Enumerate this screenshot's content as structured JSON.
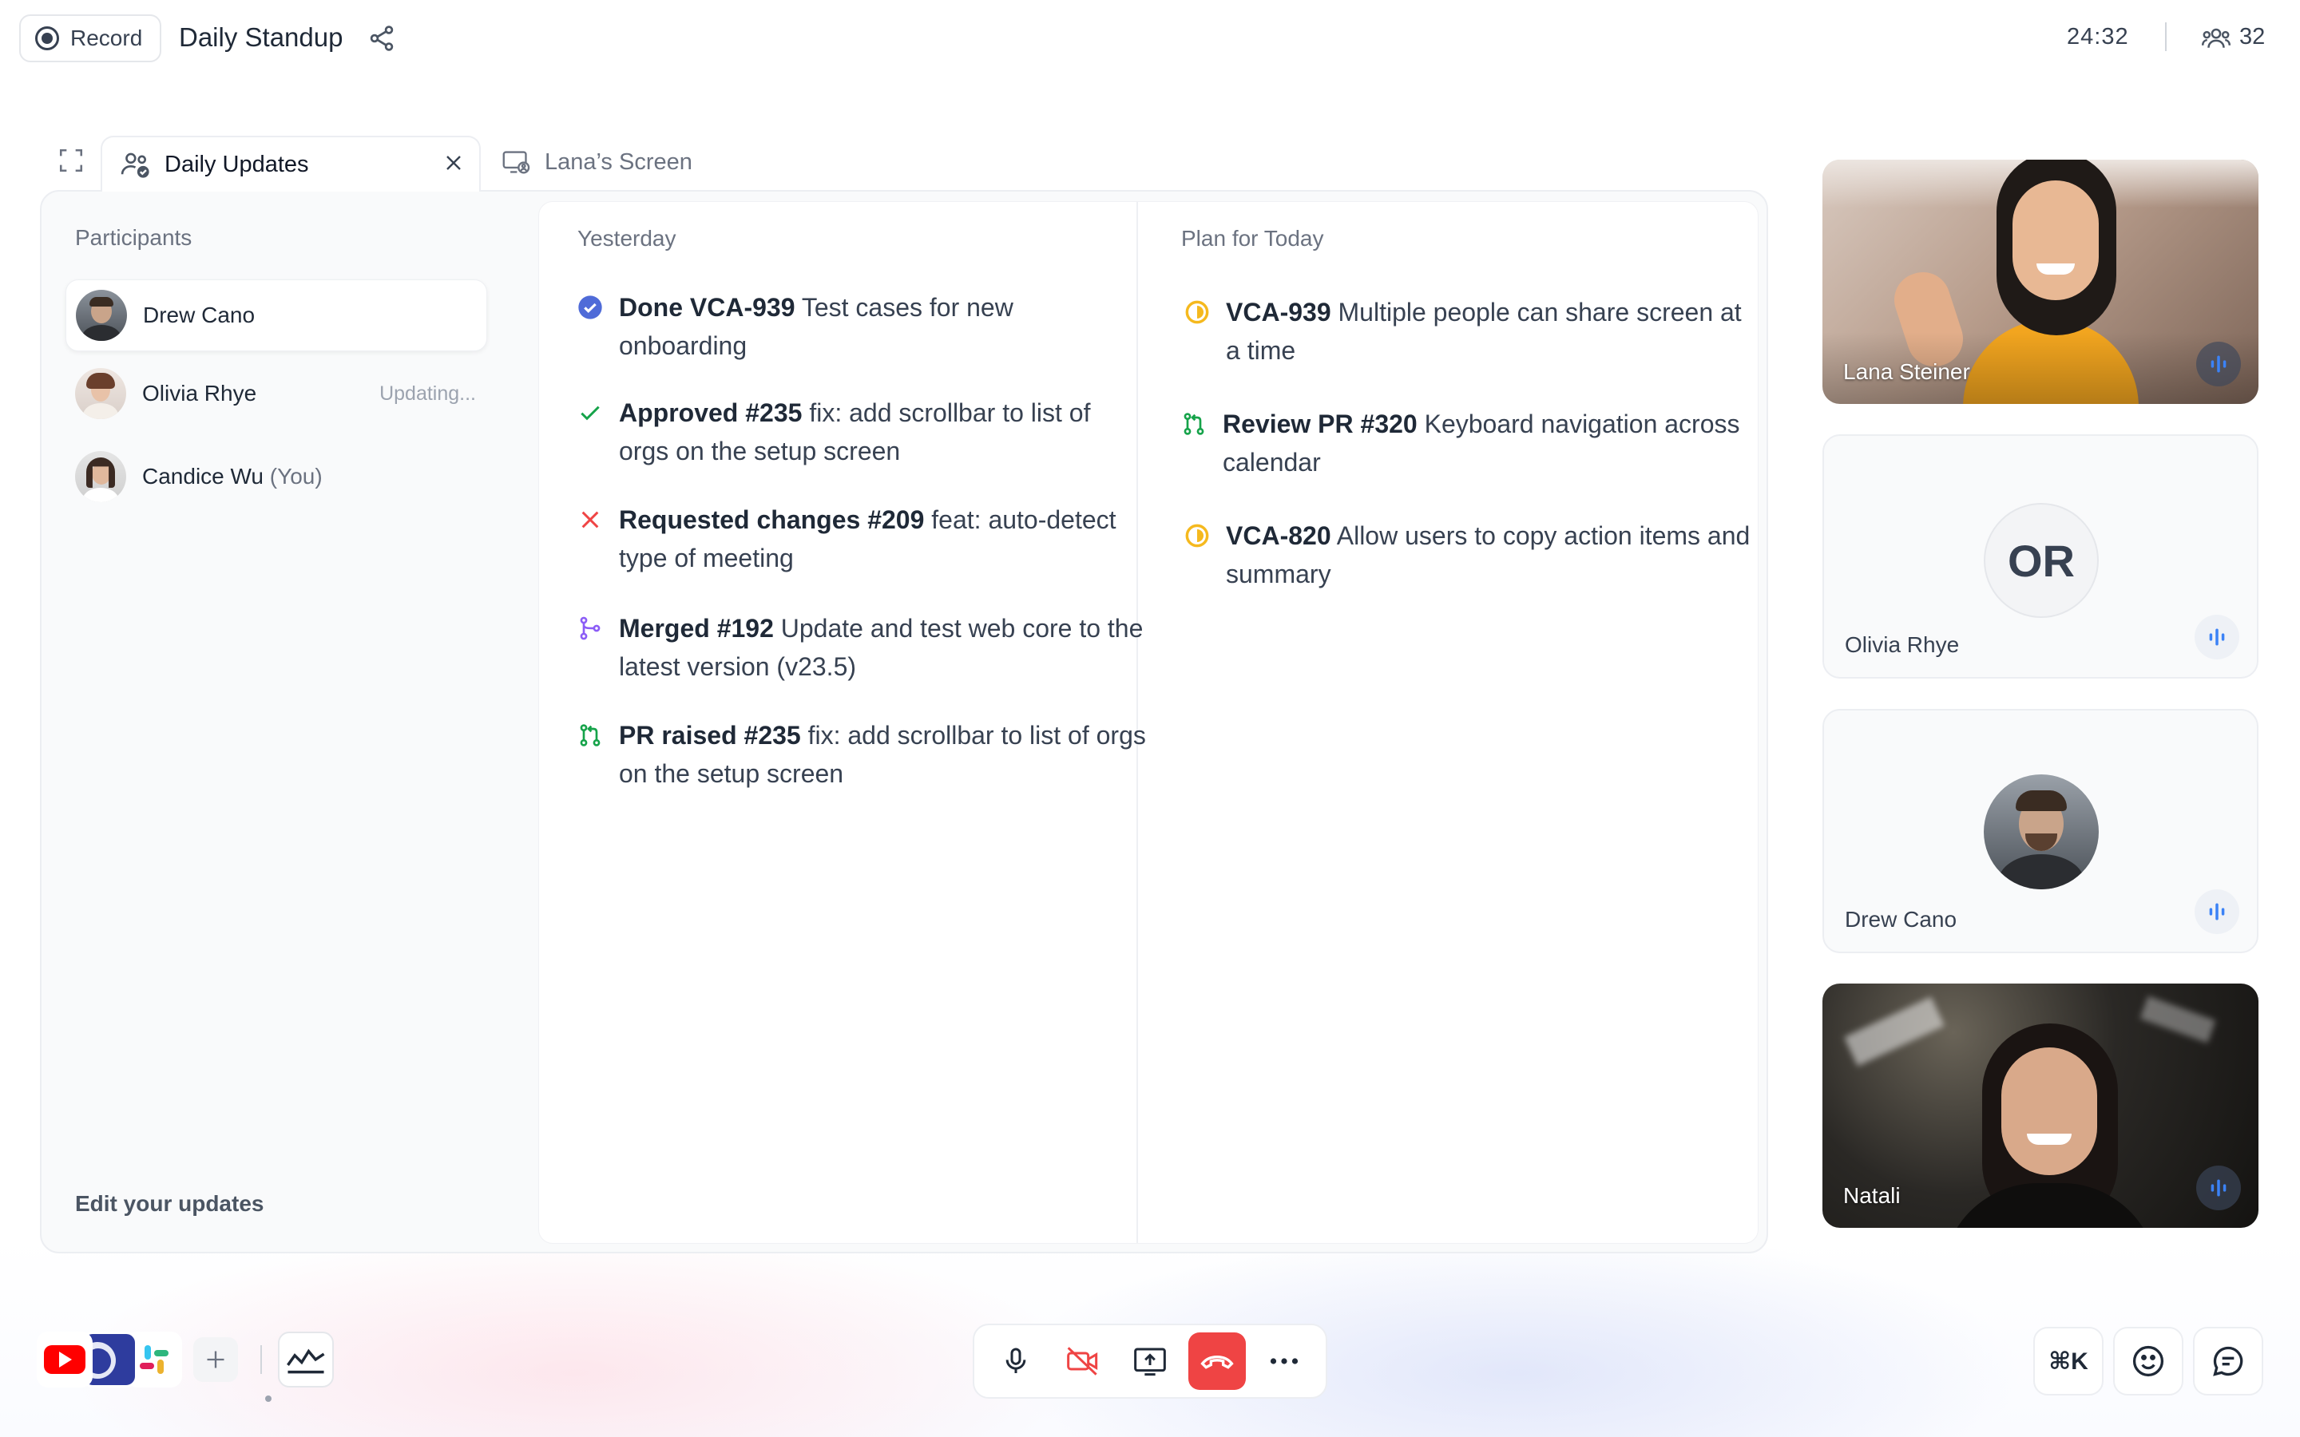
{
  "header": {
    "record_label": "Record",
    "meeting_title": "Daily Standup",
    "timer": "24:32",
    "participant_count": "32"
  },
  "tabs": [
    {
      "label": "Daily Updates",
      "active": true
    },
    {
      "label": "Lana’s Screen",
      "active": false
    }
  ],
  "participants": {
    "heading": "Participants",
    "items": [
      {
        "name": "Drew Cano",
        "status": "",
        "selected": true
      },
      {
        "name": "Olivia Rhye",
        "status": "Updating...",
        "selected": false
      },
      {
        "name": "Candice Wu",
        "suffix": "(You)",
        "status": "",
        "selected": false
      }
    ],
    "edit_label": "Edit your updates"
  },
  "yesterday": {
    "heading": "Yesterday",
    "items": [
      {
        "icon": "check-circle-icon",
        "title": "Done VCA-939",
        "text": "Test cases for new onboarding"
      },
      {
        "icon": "check-icon",
        "title": "Approved #235",
        "text": "fix: add scrollbar to list of orgs on the setup screen"
      },
      {
        "icon": "x-icon",
        "title": "Requested changes #209",
        "text": "feat: auto-detect type of meeting"
      },
      {
        "icon": "merge-icon",
        "title": "Merged #192",
        "text": "Update and test web core to the latest version (v23.5)"
      },
      {
        "icon": "pull-request-icon",
        "title": "PR raised #235",
        "text": "fix: add scrollbar to list of orgs on the setup screen"
      }
    ]
  },
  "today": {
    "heading": "Plan for Today",
    "items": [
      {
        "icon": "in-progress-icon",
        "title": "VCA-939",
        "text": "Multiple people can share screen at a time"
      },
      {
        "icon": "pull-request-icon",
        "title": "Review PR #320",
        "text": "Keyboard navigation across calendar"
      },
      {
        "icon": "in-progress-icon",
        "title": "VCA-820",
        "text": "Allow users to copy action items and summary"
      }
    ]
  },
  "video_tiles": [
    {
      "name": "Lana Steiner",
      "type": "photo"
    },
    {
      "name": "Olivia Rhye",
      "type": "initials",
      "initials": "OR"
    },
    {
      "name": "Drew Cano",
      "type": "avatar"
    },
    {
      "name": "Natali",
      "type": "photo"
    }
  ],
  "bottom": {
    "shortcut_label": "⌘K"
  },
  "colors": {
    "accent": "#4f6bd8",
    "success": "#16a34a",
    "danger": "#ef4444",
    "merge": "#8b5cf6",
    "pending": "#f5b91e",
    "speaking": "#3b82f6"
  }
}
